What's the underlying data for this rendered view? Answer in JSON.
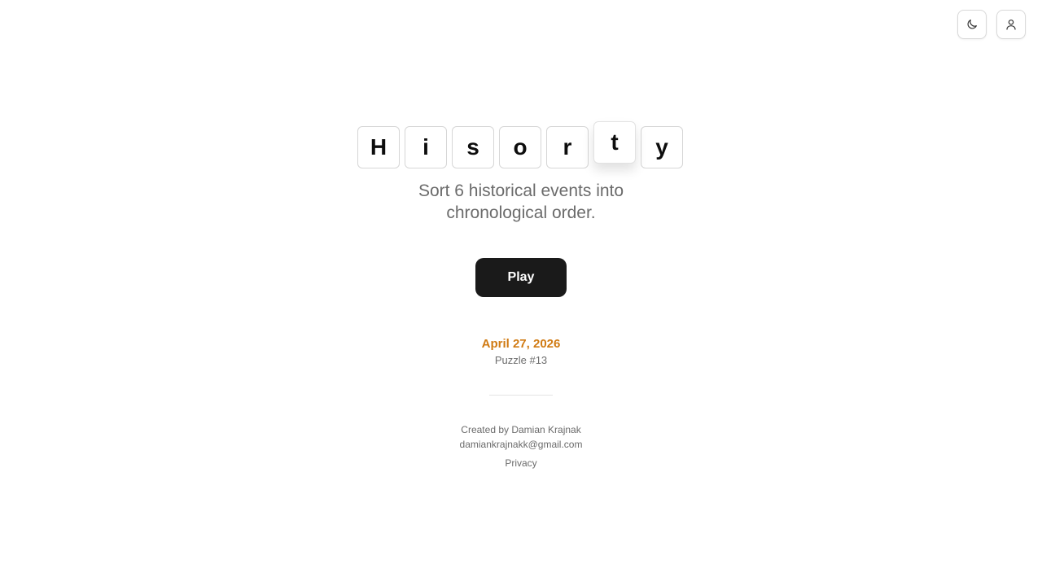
{
  "header": {
    "theme_toggle_icon": "moon-icon",
    "account_icon": "user-icon"
  },
  "logo": {
    "letters": [
      "H",
      "i",
      "s",
      "o",
      "r",
      "t",
      "y"
    ],
    "lifted_index": 5
  },
  "tagline": {
    "line1": "Sort 6 historical events into",
    "line2": "chronological order."
  },
  "actions": {
    "play_label": "Play"
  },
  "puzzle": {
    "date": "April 27, 2026",
    "number": "Puzzle #13"
  },
  "footer": {
    "credit": "Created by Damian Krajnak",
    "email": "damiankrajnakk@gmail.com",
    "privacy_label": "Privacy"
  },
  "colors": {
    "accent": "#d07a12",
    "button_bg": "#1a1a1a",
    "muted_text": "#6b6b6b"
  }
}
